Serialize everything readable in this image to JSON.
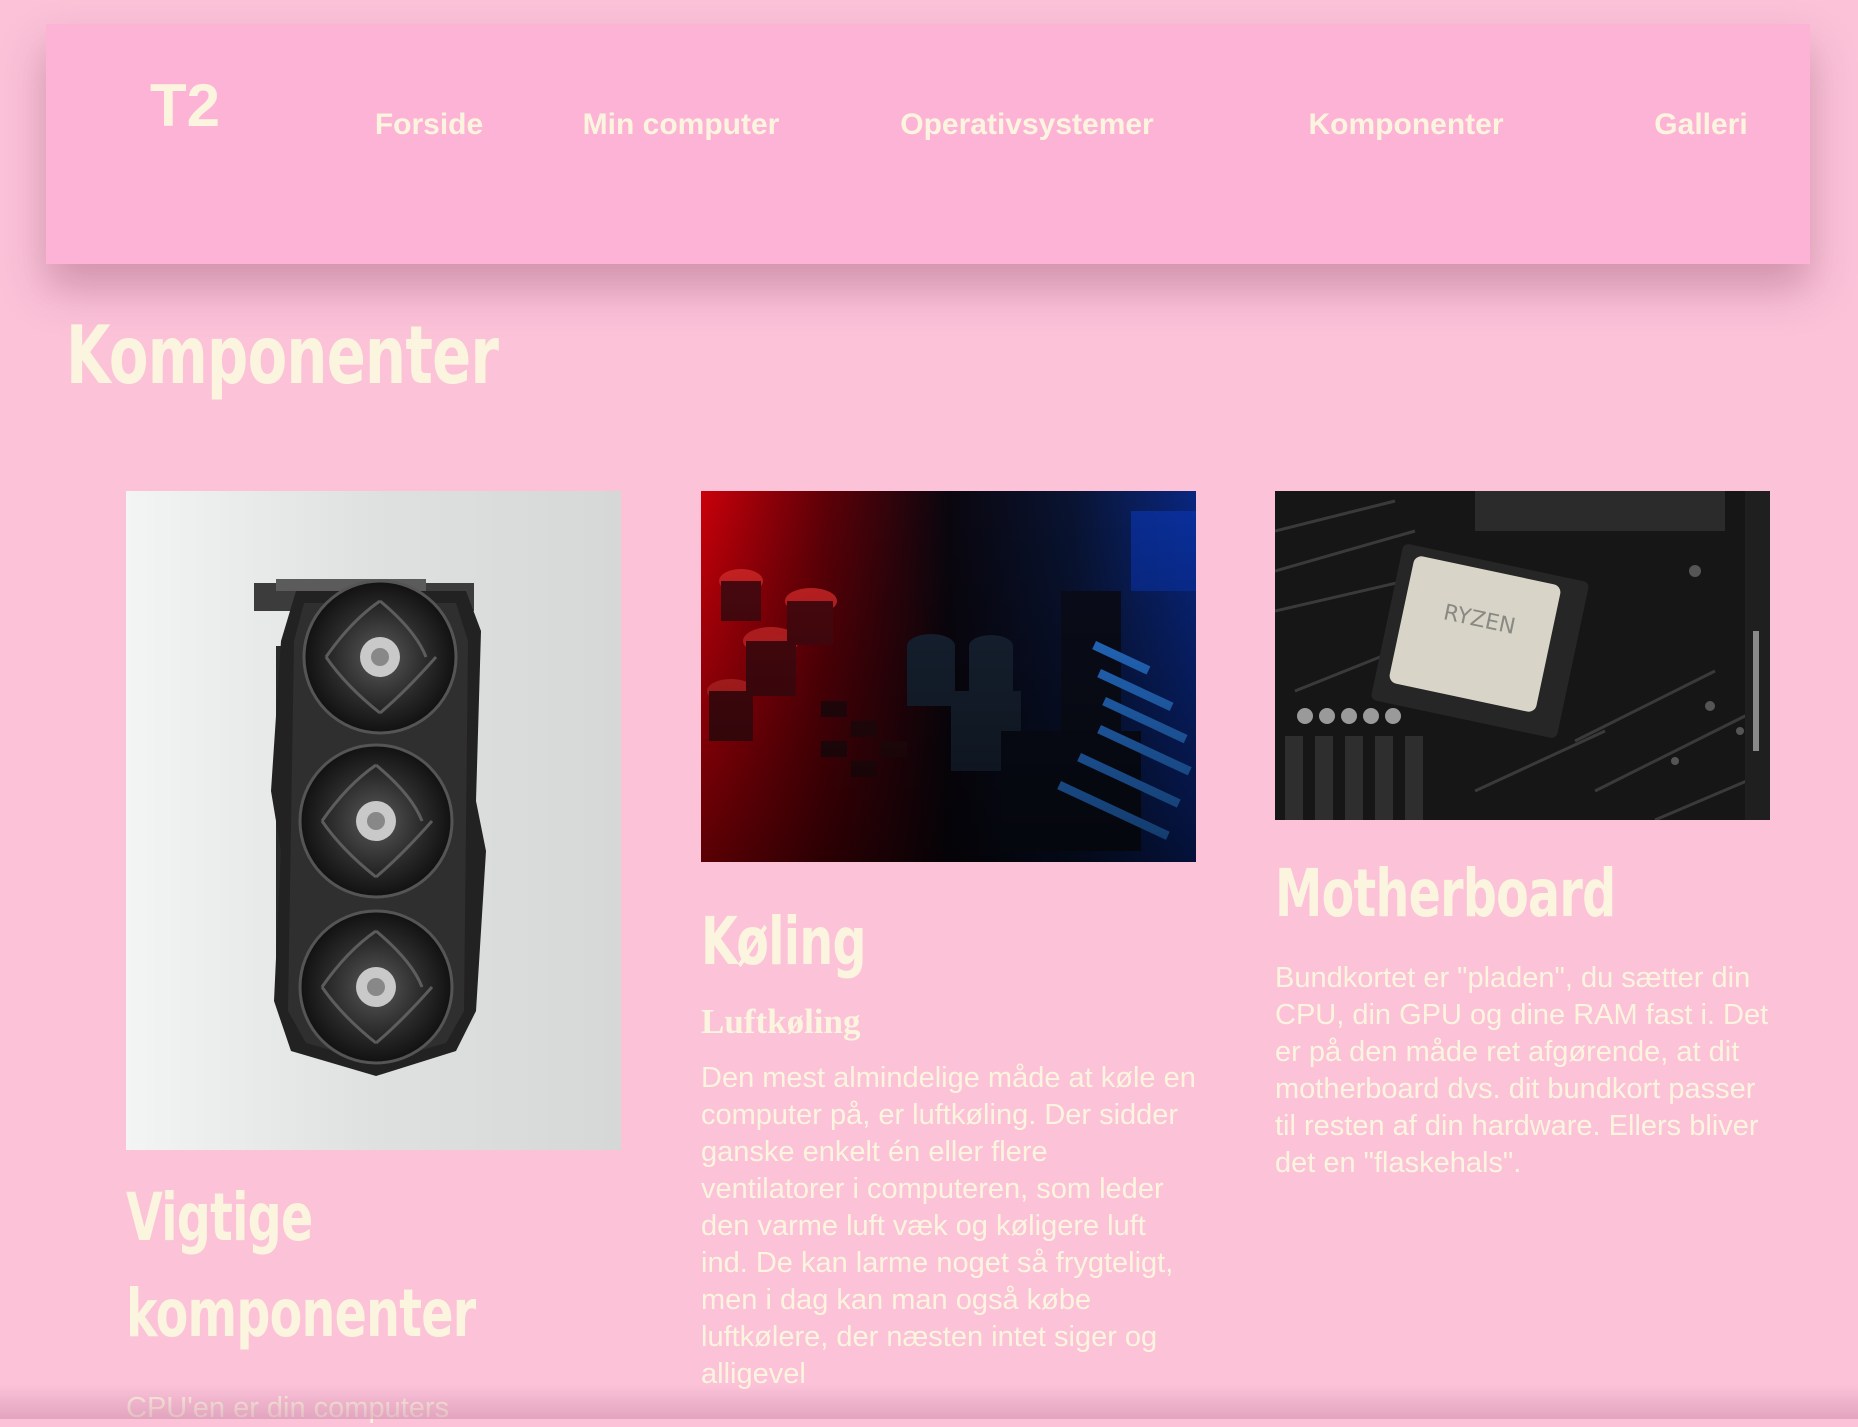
{
  "header": {
    "logo": "T2",
    "nav": [
      {
        "label": "Forside"
      },
      {
        "label": "Min computer"
      },
      {
        "label": "Operativsystemer"
      },
      {
        "label": "Komponenter"
      },
      {
        "label": "Galleri"
      }
    ]
  },
  "main": {
    "page_title": "Komponenter",
    "cards": [
      {
        "image": "graphics-card-photo",
        "title": "Vigtige komponenter",
        "text": "CPU'en er din computers"
      },
      {
        "image": "circuit-board-red-blue-photo",
        "title": "Køling",
        "subheading": "Luftkøling",
        "text": "Den mest almindelige måde at køle en computer på, er luftkøling. Der sidder ganske enkelt én eller flere ventilatorer i computeren, som leder den varme luft væk og køligere luft ind. De kan larme noget så frygteligt, men i dag kan man også købe luftkølere, der næsten intet siger og alligevel"
      },
      {
        "image": "motherboard-ryzen-photo",
        "title": "Motherboard",
        "text": "Bundkortet er \"pladen\", du sætter din CPU, din GPU og dine RAM fast i. Det er på den måde ret afgørende, at dit motherboard dvs. dit bundkort passer til resten af din hardware. Ellers bliver det en \"flaskehals\"."
      }
    ]
  },
  "colors": {
    "page_background": "#fbc2d8",
    "header_background": "#fcb3d6",
    "text": "#fbf5df"
  }
}
